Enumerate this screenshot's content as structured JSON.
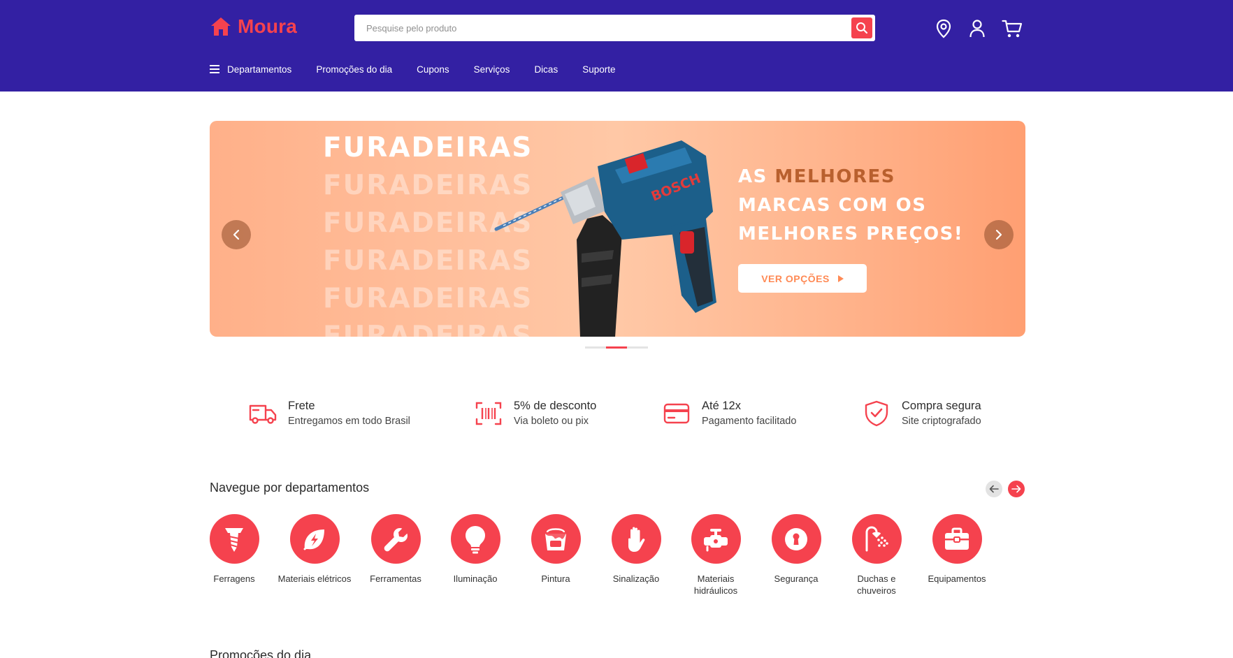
{
  "header": {
    "logo_text": "Moura",
    "search_placeholder": "Pesquise pelo produto",
    "icons": [
      "location-icon",
      "user-icon",
      "cart-icon"
    ]
  },
  "nav": {
    "departments": "Departamentos",
    "items": [
      "Promoções do dia",
      "Cupons",
      "Serviços",
      "Dicas",
      "Suporte"
    ]
  },
  "banner": {
    "headline": "FURADEIRAS",
    "drill_brand": "BOSCH",
    "promo_line1_prefix": "AS ",
    "promo_line1_highlight": "MELHORES",
    "promo_line2": "MARCAS COM OS",
    "promo_line3": "MELHORES PREÇOS!",
    "cta": "VER OPÇÕES",
    "slides": 3,
    "active_slide": 2
  },
  "features": [
    {
      "title": "Frete",
      "subtitle": "Entregamos em todo Brasil",
      "icon": "truck-icon"
    },
    {
      "title": "5% de desconto",
      "subtitle": "Via boleto ou pix",
      "icon": "barcode-icon"
    },
    {
      "title": "Até 12x",
      "subtitle": "Pagamento facilitado",
      "icon": "credit-card-icon"
    },
    {
      "title": "Compra segura",
      "subtitle": "Site criptografado",
      "icon": "shield-check-icon"
    }
  ],
  "departments": {
    "title": "Navegue por departamentos",
    "items": [
      {
        "label": "Ferragens",
        "icon": "screw-icon"
      },
      {
        "label": "Materiais elétricos",
        "icon": "electric-leaf-icon"
      },
      {
        "label": "Ferramentas",
        "icon": "wrench-icon"
      },
      {
        "label": "Iluminação",
        "icon": "lightbulb-icon"
      },
      {
        "label": "Pintura",
        "icon": "paint-bucket-icon"
      },
      {
        "label": "Sinalização",
        "icon": "hand-stop-icon"
      },
      {
        "label": "Materiais hidráulicos",
        "icon": "faucet-icon"
      },
      {
        "label": "Segurança",
        "icon": "keyhole-icon"
      },
      {
        "label": "Duchas e chuveiros",
        "icon": "shower-icon"
      },
      {
        "label": "Equipamentos",
        "icon": "toolbox-icon"
      }
    ]
  },
  "next_section_title": "Promoções do dia",
  "colors": {
    "header_bg": "#3320a3",
    "accent": "#f5424e",
    "banner_orange": "#ffb089"
  }
}
